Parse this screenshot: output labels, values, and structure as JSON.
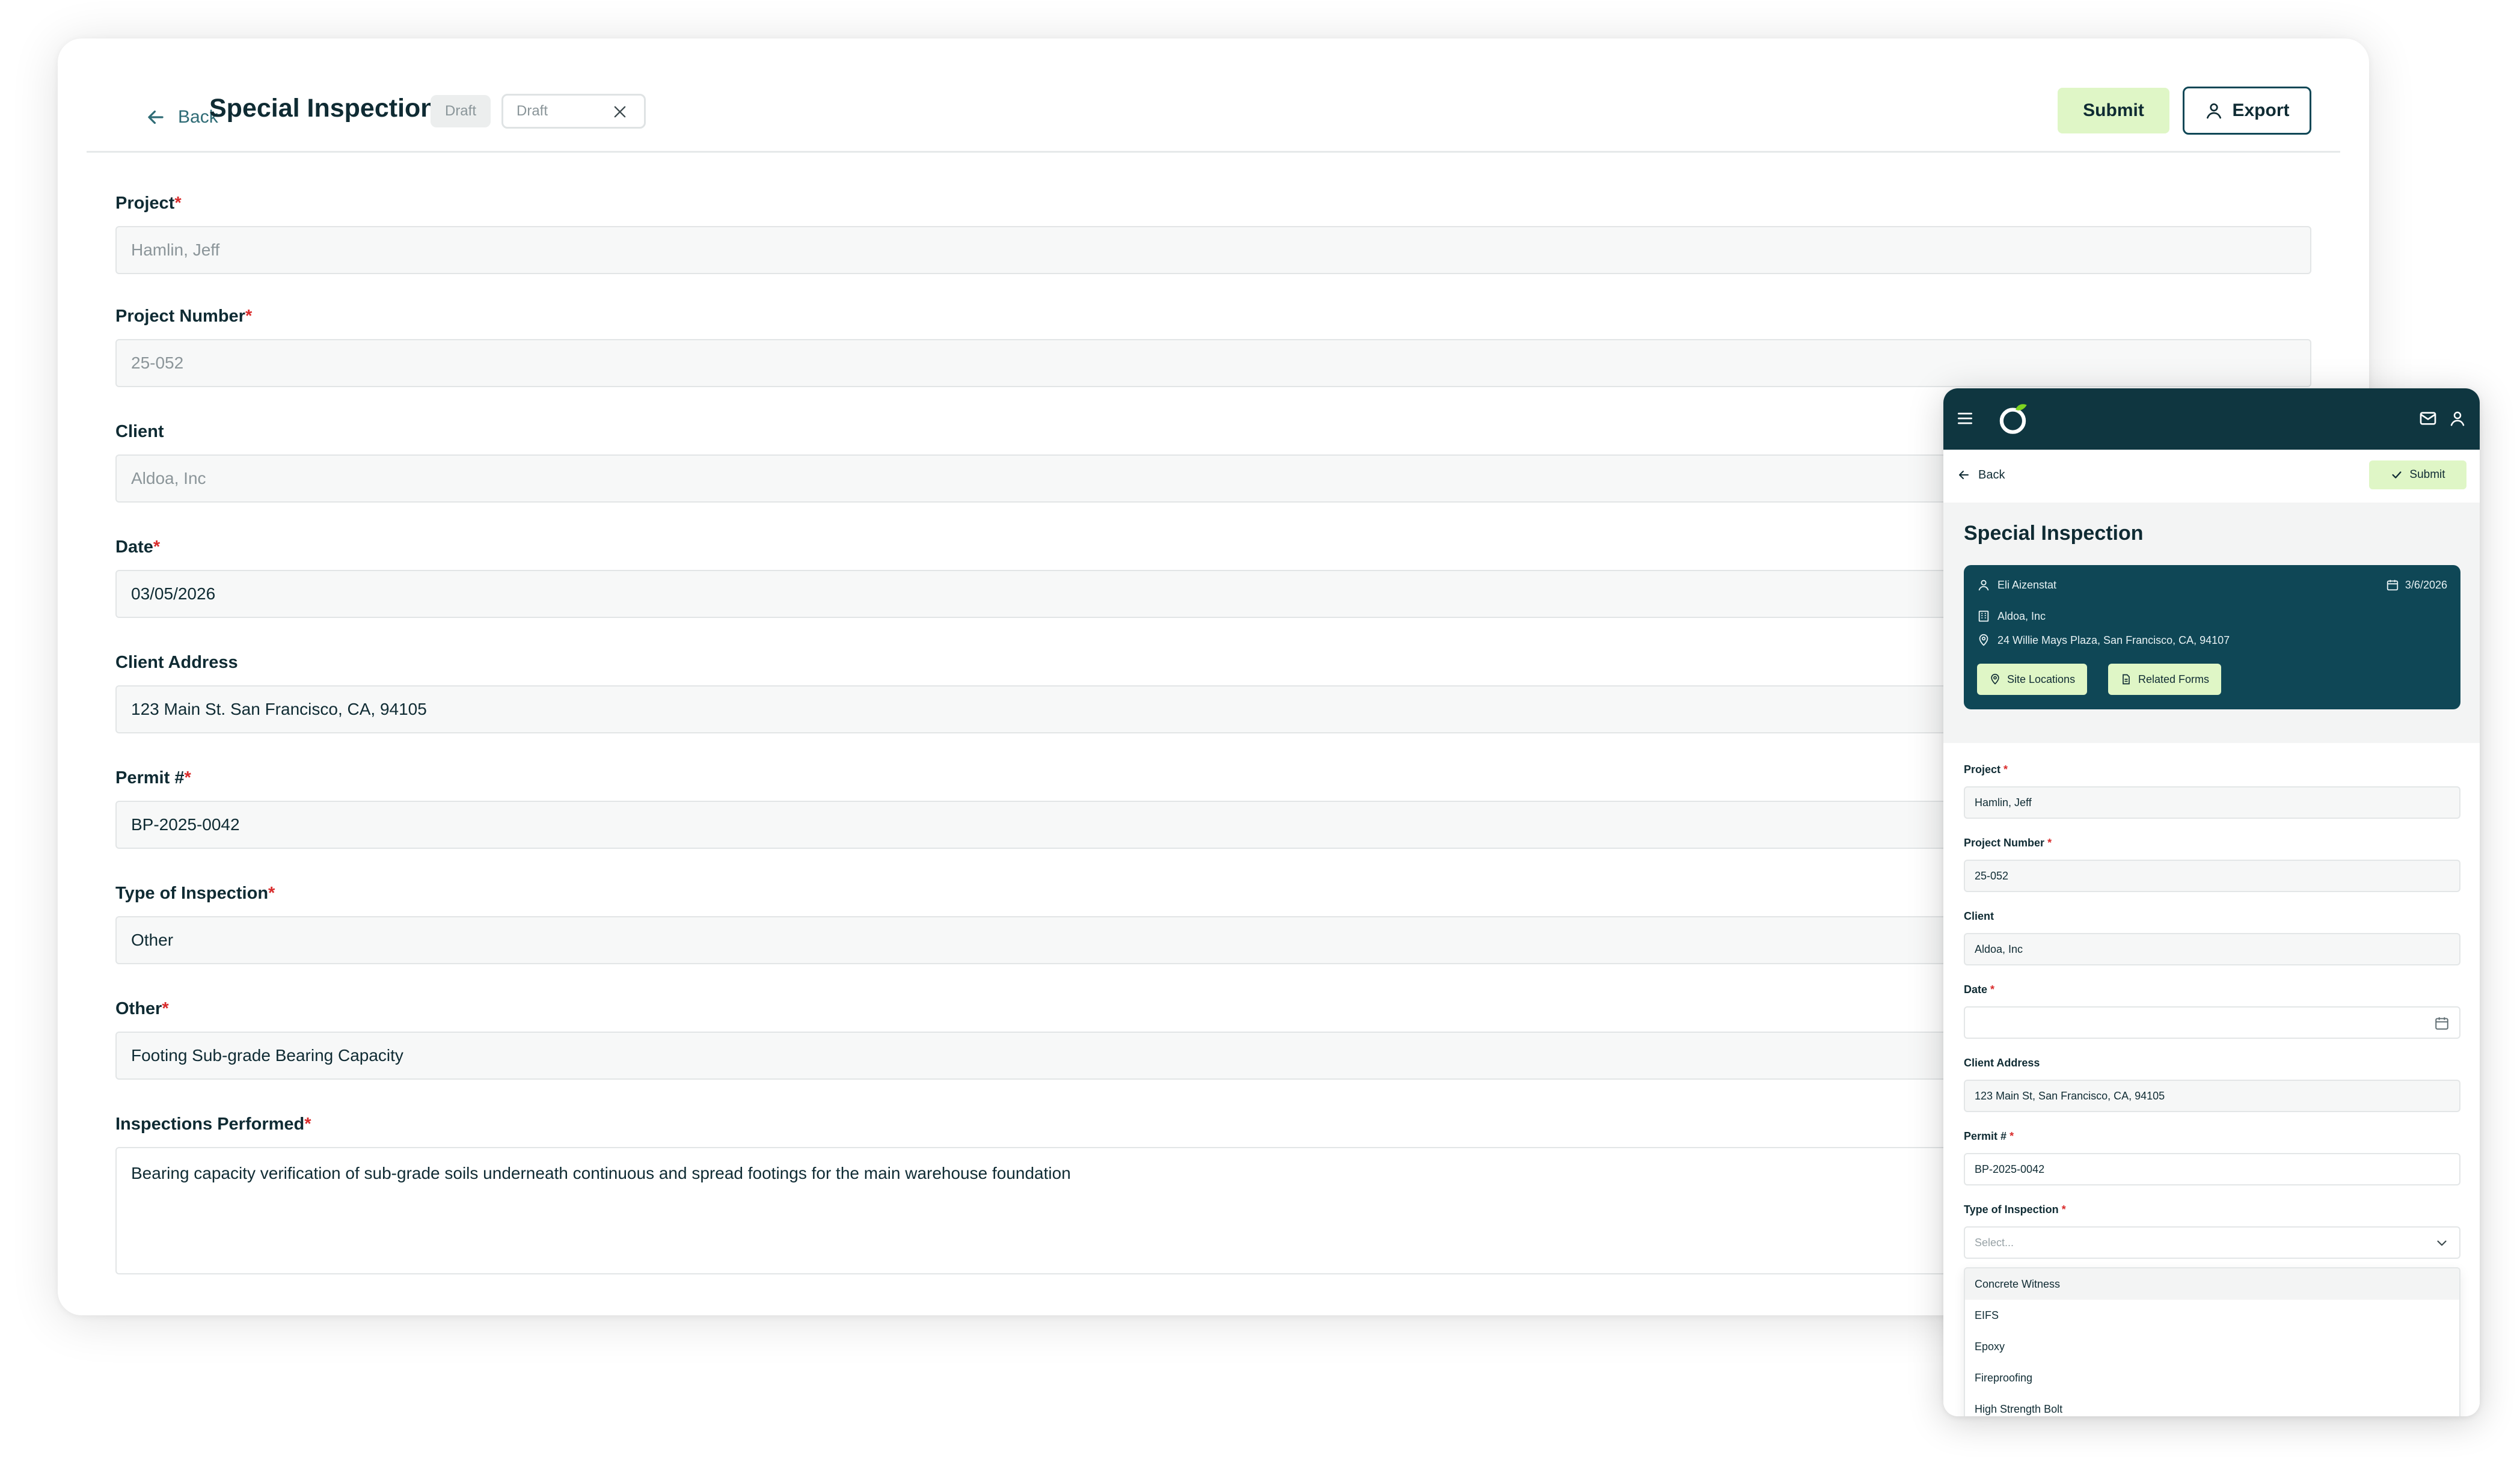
{
  "desktop": {
    "back_label": "Back",
    "title": "Special Inspection",
    "status_badge": "Draft",
    "status_select_value": "Draft",
    "submit_label": "Submit",
    "export_label": "Export",
    "fields": {
      "project": {
        "label": "Project",
        "required": "*",
        "value": "Hamlin, Jeff"
      },
      "project_number": {
        "label": "Project Number",
        "required": "*",
        "value": "25-052"
      },
      "client": {
        "label": "Client",
        "value": "Aldoa, Inc"
      },
      "date": {
        "label": "Date",
        "required": "*",
        "value": "03/05/2026"
      },
      "client_address": {
        "label": "Client Address",
        "value": "123 Main St. San Francisco, CA, 94105"
      },
      "permit": {
        "label": "Permit #",
        "required": "*",
        "value": "BP-2025-0042"
      },
      "type_of_inspection": {
        "label": "Type of Inspection",
        "required": "*",
        "value": "Other"
      },
      "other": {
        "label": "Other",
        "required": "*",
        "value": "Footing Sub-grade Bearing Capacity"
      },
      "inspections_performed": {
        "label": "Inspections Performed",
        "required": "*",
        "value": "Bearing capacity verification of sub-grade soils underneath continuous and spread footings for the main warehouse foundation"
      }
    }
  },
  "mobile": {
    "back_label": "Back",
    "submit_label": "Submit",
    "title": "Special Inspection",
    "summary": {
      "inspector": "Eli Aizenstat",
      "date": "3/6/2026",
      "client": "Aldoa, Inc",
      "address": "24 Willie Mays Plaza, San Francisco, CA, 94107",
      "site_locations_label": "Site Locations",
      "related_forms_label": "Related Forms"
    },
    "fields": {
      "project": {
        "label": "Project",
        "required": "*",
        "value": "Hamlin, Jeff"
      },
      "project_number": {
        "label": "Project Number",
        "required": "*",
        "value": "25-052"
      },
      "client": {
        "label": "Client",
        "value": "Aldoa, Inc"
      },
      "date": {
        "label": "Date",
        "required": "*",
        "value": ""
      },
      "client_address": {
        "label": "Client Address",
        "value": "123 Main St, San Francisco, CA, 94105"
      },
      "permit": {
        "label": "Permit #",
        "required": "*",
        "value": "BP-2025-0042"
      },
      "type_of_inspection": {
        "label": "Type of Inspection",
        "required": "*",
        "placeholder": "Select..."
      }
    },
    "inspection_options": [
      "Concrete Witness",
      "EIFS",
      "Epoxy",
      "Fireproofing",
      "High Strength Bolt"
    ]
  },
  "colors": {
    "brand_dark": "#0f3640",
    "card_teal": "#0f4756",
    "accent_green": "#dff6c6",
    "logo_green": "#7ed321",
    "required_red": "#d92c2c"
  }
}
